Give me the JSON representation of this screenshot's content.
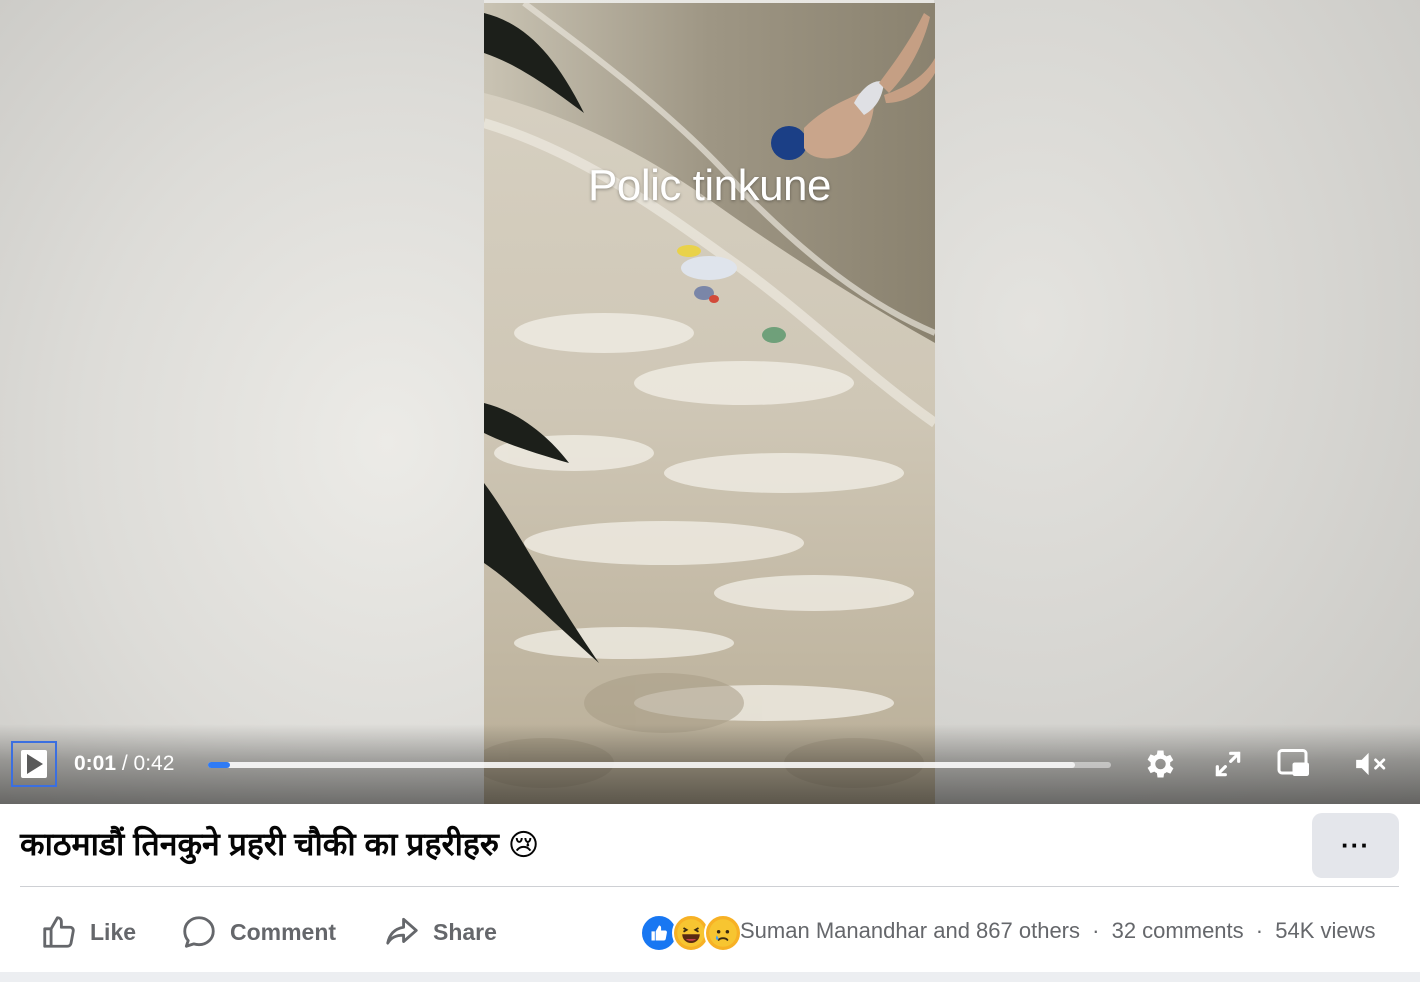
{
  "video": {
    "overlay_caption": "Polic tinkune",
    "current_time": "0:01",
    "separator": " / ",
    "duration": "0:42",
    "progress_fraction": 0.024,
    "buffered_fraction": 0.96
  },
  "controls": {
    "icons": [
      "play-icon",
      "gear-icon",
      "fullscreen-icon",
      "picture-in-picture-icon",
      "mute-icon"
    ]
  },
  "post": {
    "title": "काठमाडौं तिनकुने प्रहरी चौकी का प्रहरीहरु",
    "title_emoji": "😢",
    "more_label": "···"
  },
  "actions": {
    "like_label": "Like",
    "comment_label": "Comment",
    "share_label": "Share"
  },
  "engagement": {
    "reactors": "Suman Manandhar and 867 others",
    "dot": "·",
    "comments": "32 comments",
    "views": "54K views"
  },
  "colors": {
    "accent_blue": "#2f7bf5",
    "text_primary": "#050505",
    "text_secondary": "#65676b",
    "button_bg": "#e4e6eb"
  }
}
